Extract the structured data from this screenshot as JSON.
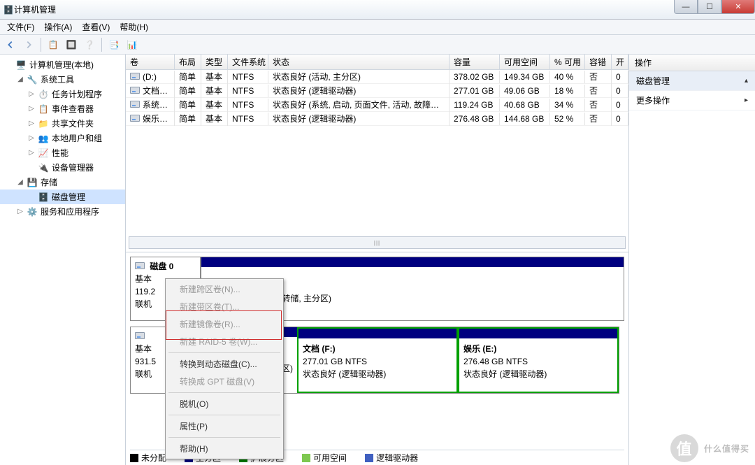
{
  "window": {
    "title": "计算机管理"
  },
  "menu": {
    "file": "文件(F)",
    "action": "操作(A)",
    "view": "查看(V)",
    "help": "帮助(H)"
  },
  "tree": {
    "root": "计算机管理(本地)",
    "sys_tools": "系统工具",
    "task_scheduler": "任务计划程序",
    "event_viewer": "事件查看器",
    "shared_folders": "共享文件夹",
    "local_users": "本地用户和组",
    "performance": "性能",
    "device_manager": "设备管理器",
    "storage": "存储",
    "disk_management": "磁盘管理",
    "services_apps": "服务和应用程序"
  },
  "columns": {
    "volume": "卷",
    "layout": "布局",
    "type": "类型",
    "fs": "文件系统",
    "status": "状态",
    "capacity": "容量",
    "free": "可用空间",
    "pct": "% 可用",
    "fault": "容错",
    "overhead": "开"
  },
  "volumes": [
    {
      "name": "(D:)",
      "layout": "简单",
      "type": "基本",
      "fs": "NTFS",
      "status": "状态良好 (活动, 主分区)",
      "capacity": "378.02 GB",
      "free": "149.34 GB",
      "pct": "40 %",
      "fault": "否",
      "oh": "0"
    },
    {
      "name": "文档 (F:)",
      "layout": "简单",
      "type": "基本",
      "fs": "NTFS",
      "status": "状态良好 (逻辑驱动器)",
      "capacity": "277.01 GB",
      "free": "49.06 GB",
      "pct": "18 %",
      "fault": "否",
      "oh": "0"
    },
    {
      "name": "系统 (C:)",
      "layout": "简单",
      "type": "基本",
      "fs": "NTFS",
      "status": "状态良好 (系统, 启动, 页面文件, 活动, 故障转储, 主分区)",
      "capacity": "119.24 GB",
      "free": "40.68 GB",
      "pct": "34 %",
      "fault": "否",
      "oh": "0"
    },
    {
      "name": "娱乐 (E:)",
      "layout": "简单",
      "type": "基本",
      "fs": "NTFS",
      "status": "状态良好 (逻辑驱动器)",
      "capacity": "276.48 GB",
      "free": "144.68 GB",
      "pct": "52 %",
      "fault": "否",
      "oh": "0"
    }
  ],
  "disk0": {
    "title": "磁盘 0",
    "sub1": "基本",
    "sub2": "119.2",
    "sub3": "联机",
    "part_status_fragment": "页面文件, 活动, 故障转储, 主分区)"
  },
  "disk1": {
    "sub1": "基本",
    "sub2": "931.5",
    "sub3": "联机",
    "frag": "区)",
    "partF": {
      "title": "文档  (F:)",
      "size": "277.01 GB NTFS",
      "status": "状态良好 (逻辑驱动器)"
    },
    "partE": {
      "title": "娱乐  (E:)",
      "size": "276.48 GB NTFS",
      "status": "状态良好 (逻辑驱动器)"
    }
  },
  "context": {
    "spanned": "新建跨区卷(N)...",
    "striped": "新建带区卷(T)...",
    "mirror": "新建镜像卷(R)...",
    "raid5": "新建 RAID-5 卷(W)...",
    "to_dynamic": "转换到动态磁盘(C)...",
    "to_gpt": "转换成 GPT 磁盘(V)",
    "offline": "脱机(O)",
    "properties": "属性(P)",
    "help": "帮助(H)"
  },
  "legend": {
    "unalloc": "未分配",
    "primary": "主分区",
    "extended": "扩展分区",
    "free": "可用空间",
    "logical": "逻辑驱动器"
  },
  "actions": {
    "header": "操作",
    "disk_mgmt": "磁盘管理",
    "more": "更多操作"
  },
  "watermark": "什么值得买"
}
